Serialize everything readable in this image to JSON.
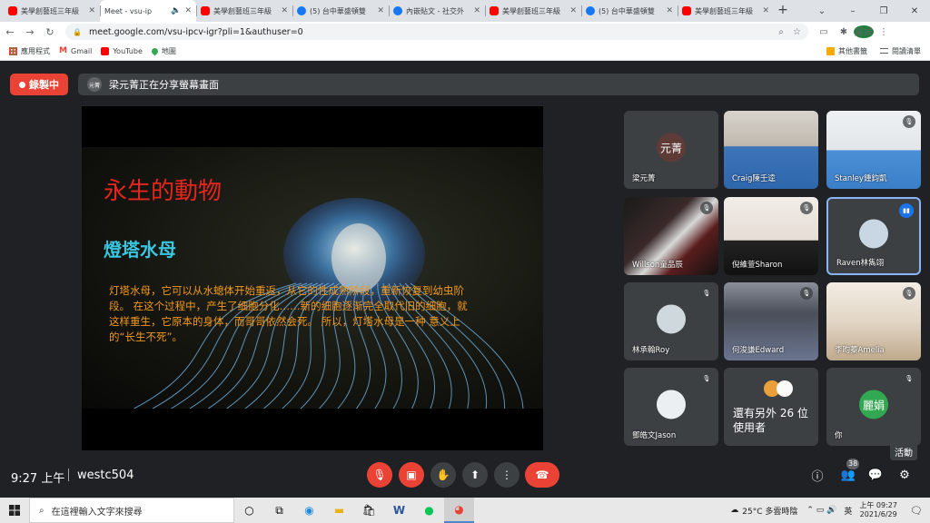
{
  "browser": {
    "tabs": [
      {
        "title": "美學創藝班三年級",
        "favicon": "youtube-icon",
        "active": false
      },
      {
        "title": "Meet - vsu-ip",
        "favicon": "meet-icon",
        "active": true
      },
      {
        "title": "美學創藝班三年級",
        "favicon": "youtube-icon",
        "active": false
      },
      {
        "title": "(5) 台中華盛頓雙",
        "favicon": "facebook-icon",
        "active": false
      },
      {
        "title": "內嵌貼文 - 社交外",
        "favicon": "facebook-icon",
        "active": false
      },
      {
        "title": "美學創藝班三年級",
        "favicon": "youtube-icon",
        "active": false
      },
      {
        "title": "(5) 台中華盛頓雙",
        "favicon": "facebook-icon",
        "active": false
      },
      {
        "title": "美學創藝班三年級",
        "favicon": "youtube-icon",
        "active": false
      }
    ],
    "url": "meet.google.com/vsu-ipcv-igr?pli=1&authuser=0",
    "profile_initials": "麗娟",
    "bookmarks": [
      "應用程式",
      "Gmail",
      "YouTube",
      "地圖"
    ],
    "bookmarks_right": [
      "其他書籤",
      "閱讀清單"
    ]
  },
  "meet": {
    "recording_label": "錄製中",
    "presenter_initials": "元菁",
    "share_banner": "梁元菁正在分享螢幕畫面",
    "slide": {
      "title": "永生的動物",
      "subtitle": "燈塔水母",
      "body": "灯塔水母，它可以从水螅体开始重返，从它的性成熟阶段，重新恢复到幼虫阶段。 在这个过程中，产生了细胞分化……新的细胞逐渐完全取代旧的细胞，就这样重生，它原本的身体，而哥哥依然会死。 所以，灯塔水母是一种 意义上的“长生不死”。"
    },
    "participants": [
      {
        "name": "梁元菁",
        "avatar": "元菁",
        "kind": "avatar",
        "avatar_color": "#5f3b37",
        "muted": false
      },
      {
        "name": "Craig陳壬逵",
        "kind": "video",
        "muted": false
      },
      {
        "name": "Stanley鍾鈞凱",
        "kind": "video",
        "muted": true
      },
      {
        "name": "Willson童品辰",
        "kind": "video",
        "muted": true
      },
      {
        "name": "倪維萱Sharon",
        "kind": "video",
        "muted": true
      },
      {
        "name": "Raven林雋翊",
        "kind": "avatar",
        "avatar_color": "#c9d6e3",
        "muted": false,
        "speaking": true
      },
      {
        "name": "林承翰Roy",
        "kind": "avatar",
        "avatar_color": "#cfd8dc",
        "muted": true
      },
      {
        "name": "何浚謙Edward",
        "kind": "video",
        "muted": true
      },
      {
        "name": "李昀蓁Amelia",
        "kind": "video",
        "muted": true
      },
      {
        "name": "鄧皓文Jason",
        "kind": "avatar",
        "avatar_color": "#eceff1",
        "muted": true
      },
      {
        "name": "還有另外 26 位使用者",
        "kind": "others",
        "muted": false
      },
      {
        "name": "你",
        "avatar": "麗娟",
        "kind": "avatar",
        "avatar_color": "#33a852",
        "muted": true
      }
    ],
    "time": "9:27 上午",
    "meeting_code": "westc504",
    "people_count": "38",
    "activities_tooltip": "活動"
  },
  "taskbar": {
    "search_placeholder": "在這裡輸入文字來搜尋",
    "weather": "25°C 多雲時陰",
    "ime": "英",
    "time": "上午 09:27",
    "date": "2021/6/29"
  },
  "colors": {
    "accent": "#8ab4f8",
    "danger": "#ea4335",
    "panel": "#3c4043",
    "bg": "#202124"
  }
}
